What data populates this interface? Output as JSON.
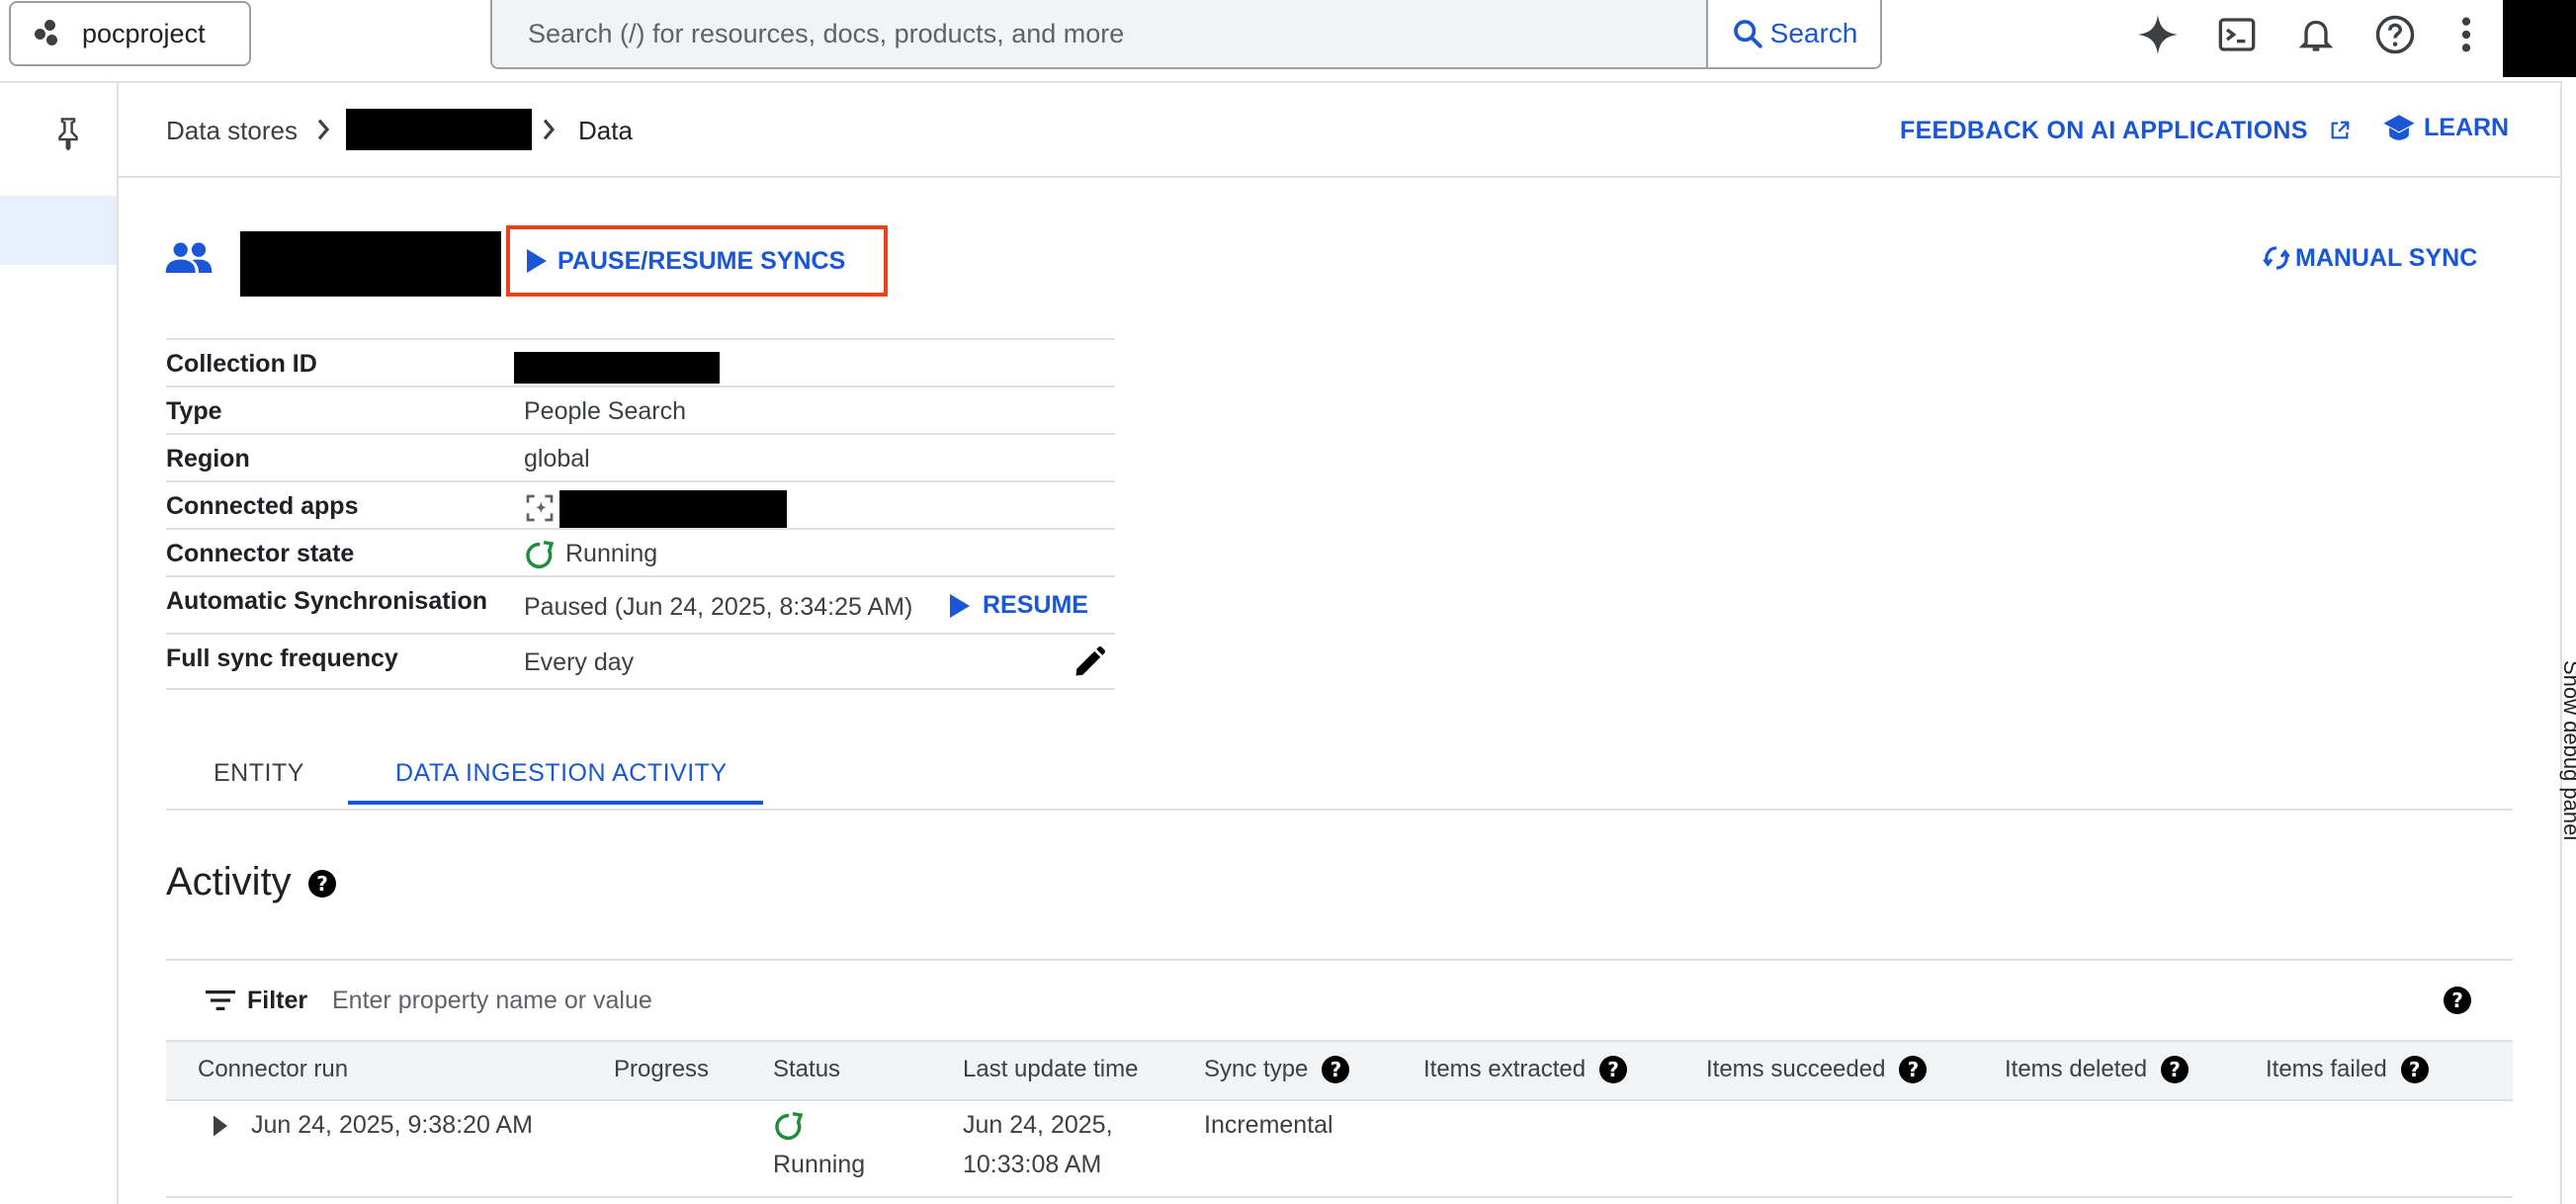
{
  "topbar": {
    "project_name": "pocproject",
    "search_placeholder": "Search (/) for resources, docs, products, and more",
    "search_button": "Search"
  },
  "breadcrumb": {
    "root": "Data stores",
    "current": "Data"
  },
  "header_links": {
    "feedback": "FEEDBACK ON AI APPLICATIONS",
    "learn": "LEARN"
  },
  "datastore": {
    "pause_resume": "PAUSE/RESUME SYNCS",
    "manual_sync": "MANUAL SYNC"
  },
  "details": {
    "collection_id_label": "Collection ID",
    "type_label": "Type",
    "type_value": "People Search",
    "region_label": "Region",
    "region_value": "global",
    "connected_apps_label": "Connected apps",
    "connector_state_label": "Connector state",
    "connector_state_value": "Running",
    "auto_sync_label": "Automatic Synchronisation",
    "auto_sync_value": "Paused (Jun 24, 2025, 8:34:25 AM)",
    "resume_label": "RESUME",
    "full_sync_label": "Full sync frequency",
    "full_sync_value": "Every day"
  },
  "tabs": [
    {
      "label": "ENTITY"
    },
    {
      "label": "DATA INGESTION ACTIVITY"
    }
  ],
  "activity": {
    "title": "Activity",
    "filter_label": "Filter",
    "filter_placeholder": "Enter property name or value",
    "columns": [
      "Connector run",
      "Progress",
      "Status",
      "Last update time",
      "Sync type",
      "Items extracted",
      "Items succeeded",
      "Items deleted",
      "Items failed"
    ],
    "rows": [
      {
        "connector_run": "Jun 24, 2025, 9:38:20 AM",
        "status": "Running",
        "last_update_line1": "Jun 24, 2025,",
        "last_update_line2": "10:33:08 AM",
        "sync_type": "Incremental"
      }
    ]
  },
  "side_panel": {
    "debug_label": "Show debug panel"
  },
  "colors": {
    "accent": "#1a56d6",
    "highlight_border": "#e8421f",
    "running_green": "#1e8e3e"
  }
}
